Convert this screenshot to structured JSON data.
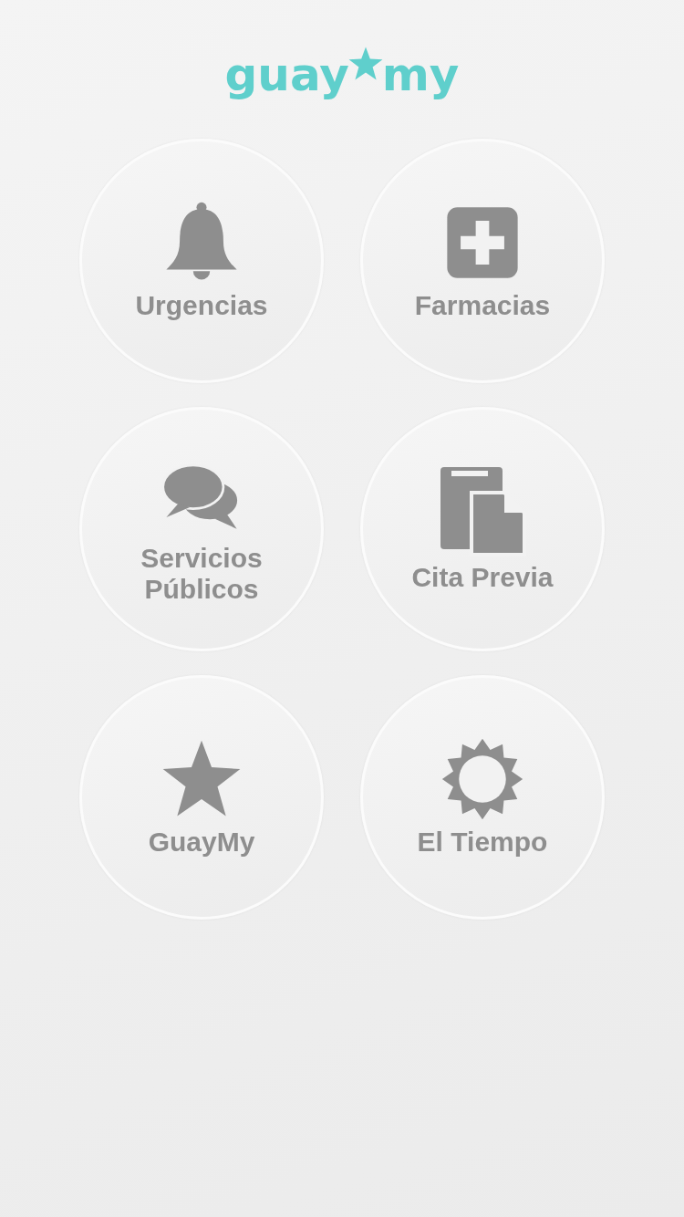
{
  "logo": {
    "left": "guay",
    "right": "my"
  },
  "tiles": [
    {
      "label": "Urgencias",
      "kind": "bell"
    },
    {
      "label": "Farmacias",
      "kind": "plus"
    },
    {
      "label": "Servicios Públicos",
      "kind": "chat"
    },
    {
      "label": "Cita Previa",
      "kind": "document"
    },
    {
      "label": "GuayMy",
      "kind": "star"
    },
    {
      "label": "El Tiempo",
      "kind": "sun"
    }
  ]
}
